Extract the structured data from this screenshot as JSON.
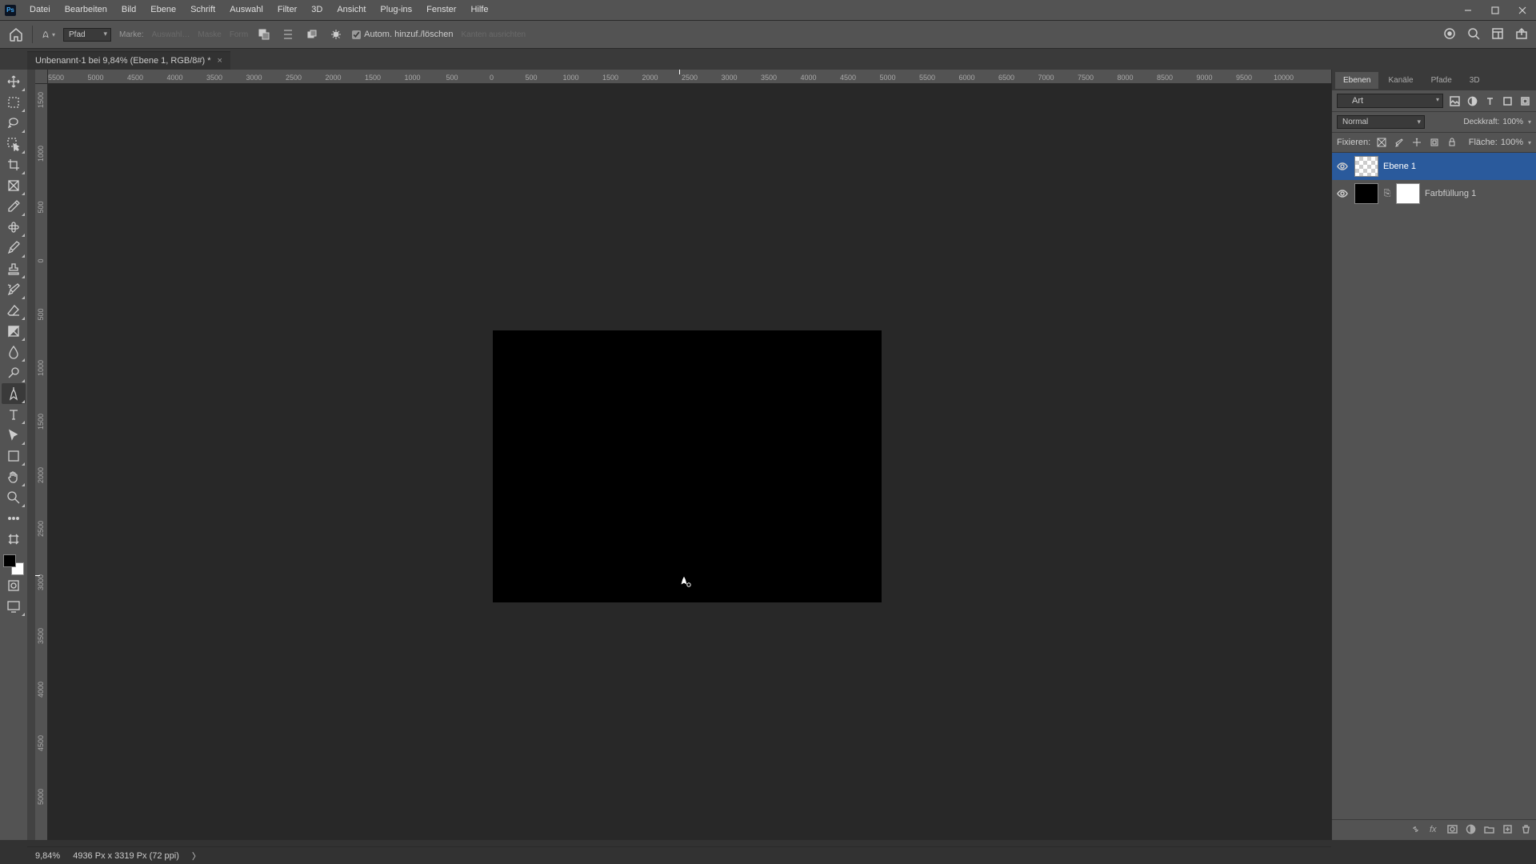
{
  "menubar": {
    "items": [
      "Datei",
      "Bearbeiten",
      "Bild",
      "Ebene",
      "Schrift",
      "Auswahl",
      "Filter",
      "3D",
      "Ansicht",
      "Plug-ins",
      "Fenster",
      "Hilfe"
    ]
  },
  "optionsbar": {
    "mode_label": "Pfad",
    "marker_label": "Marke:",
    "auswahl_label": "Auswahl…",
    "maske_label": "Maske",
    "form_label": "Form",
    "auto_label": "Autom. hinzuf./löschen",
    "kanten_label": "Kanten ausrichten"
  },
  "document": {
    "tab_title": "Unbenannt-1 bei 9,84% (Ebene 1, RGB/8#) *"
  },
  "ruler": {
    "h_ticks": [
      "5500",
      "5000",
      "4500",
      "4000",
      "3500",
      "3000",
      "2500",
      "2000",
      "1500",
      "1000",
      "500",
      "0",
      "500",
      "1000",
      "1500",
      "2000",
      "2500",
      "3000",
      "3500",
      "4000",
      "4500",
      "5000",
      "5500",
      "6000",
      "6500",
      "7000",
      "7500",
      "8000",
      "8500",
      "9000",
      "9500",
      "10000"
    ],
    "v_ticks": [
      "1500",
      "1000",
      "500",
      "0",
      "500",
      "1000",
      "1500",
      "2000",
      "2500",
      "3000",
      "3500",
      "4000",
      "4500",
      "5000"
    ]
  },
  "rightpanel": {
    "tabs": [
      "Ebenen",
      "Kanäle",
      "Pfade",
      "3D"
    ],
    "search_placeholder": "Art",
    "blend_mode": "Normal",
    "opacity_label": "Deckkraft:",
    "opacity_value": "100%",
    "fixieren_label": "Fixieren:",
    "fill_label": "Fläche:",
    "fill_value": "100%",
    "layers": [
      {
        "name": "Ebene 1"
      },
      {
        "name": "Farbfüllung 1"
      }
    ]
  },
  "statusbar": {
    "zoom": "9,84%",
    "docinfo": "4936 Px x 3319 Px (72 ppi)"
  },
  "tool_icons": [
    "move",
    "marquee",
    "lasso",
    "wand",
    "crop",
    "frame",
    "eyedropper",
    "heal",
    "brush",
    "stamp",
    "history",
    "eraser",
    "gradient",
    "blur",
    "dodge",
    "pen",
    "type",
    "path",
    "shape",
    "hand",
    "zoom",
    "more",
    "edit-toolbar"
  ]
}
